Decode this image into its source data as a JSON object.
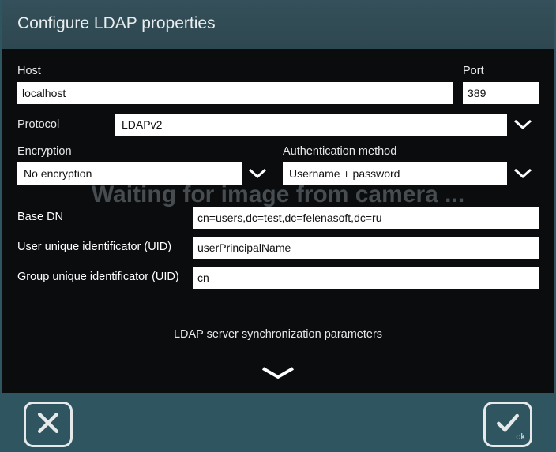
{
  "title": "Configure LDAP properties",
  "background_text": "Waiting for image from camera ...",
  "host": {
    "label": "Host",
    "value": "localhost"
  },
  "port": {
    "label": "Port",
    "value": "389"
  },
  "protocol": {
    "label": "Protocol",
    "value": "LDAPv2"
  },
  "encryption": {
    "label": "Encryption",
    "value": "No encryption"
  },
  "auth": {
    "label": "Authentication method",
    "value": "Username + password"
  },
  "base_dn": {
    "label": "Base DN",
    "value": "cn=users,dc=test,dc=felenasoft,dc=ru"
  },
  "user_uid": {
    "label": "User unique identificator (UID)",
    "value": "userPrincipalName"
  },
  "group_uid": {
    "label": "Group unique identificator (UID)",
    "value": "cn"
  },
  "sync_section_title": "LDAP server synchronization parameters",
  "ok_label": "ok"
}
